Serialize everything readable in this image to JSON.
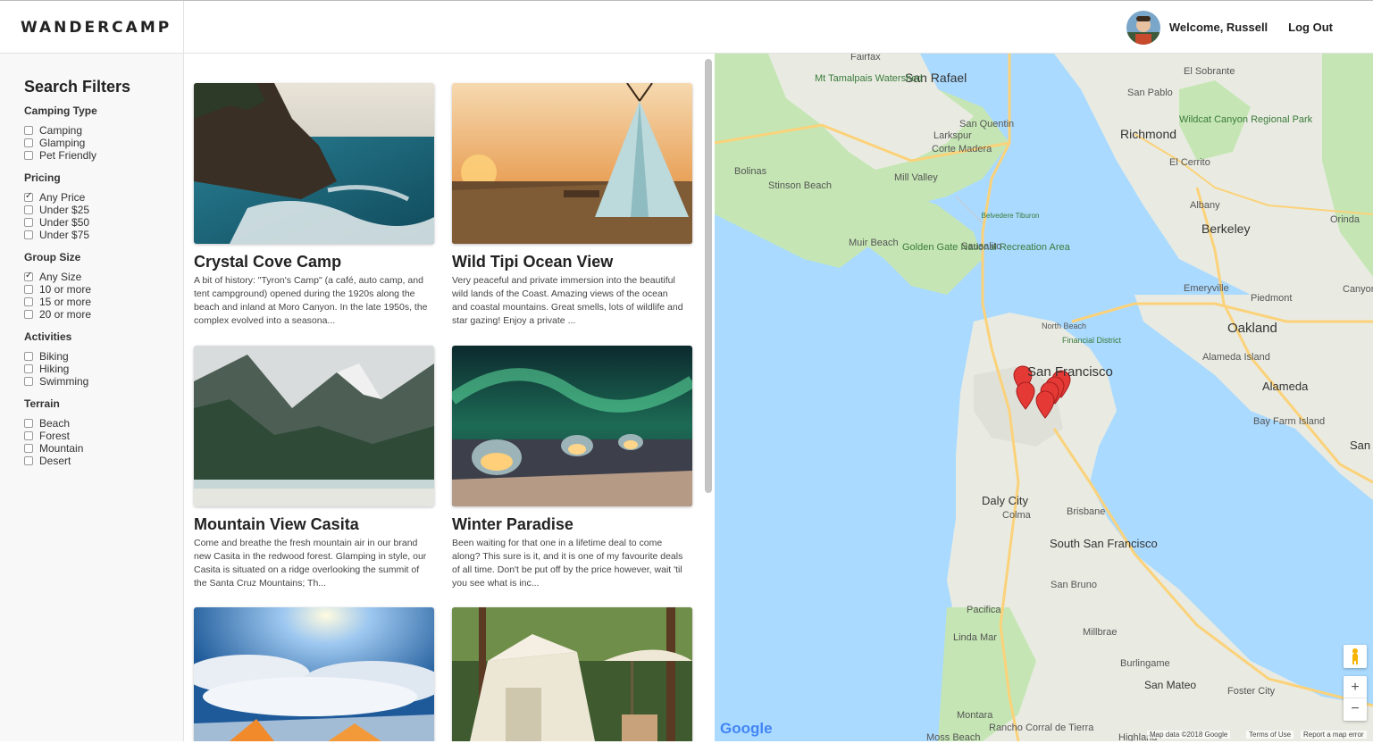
{
  "header": {
    "brand": "WANDERCAMP",
    "welcome": "Welcome, Russell",
    "logout": "Log Out"
  },
  "filters": {
    "title": "Search Filters",
    "groups": [
      {
        "label": "Camping Type",
        "options": [
          {
            "label": "Camping",
            "checked": false
          },
          {
            "label": "Glamping",
            "checked": false
          },
          {
            "label": "Pet Friendly",
            "checked": false
          }
        ]
      },
      {
        "label": "Pricing",
        "options": [
          {
            "label": "Any Price",
            "checked": true
          },
          {
            "label": "Under $25",
            "checked": false
          },
          {
            "label": "Under $50",
            "checked": false
          },
          {
            "label": "Under $75",
            "checked": false
          }
        ]
      },
      {
        "label": "Group Size",
        "options": [
          {
            "label": "Any Size",
            "checked": true
          },
          {
            "label": "10 or more",
            "checked": false
          },
          {
            "label": "15 or more",
            "checked": false
          },
          {
            "label": "20 or more",
            "checked": false
          }
        ]
      },
      {
        "label": "Activities",
        "options": [
          {
            "label": "Biking",
            "checked": false
          },
          {
            "label": "Hiking",
            "checked": false
          },
          {
            "label": "Swimming",
            "checked": false
          }
        ]
      },
      {
        "label": "Terrain",
        "options": [
          {
            "label": "Beach",
            "checked": false
          },
          {
            "label": "Forest",
            "checked": false
          },
          {
            "label": "Mountain",
            "checked": false
          },
          {
            "label": "Desert",
            "checked": false
          }
        ]
      }
    ]
  },
  "listings": [
    {
      "title": "Crystal Cove Camp",
      "desc": "A bit of history: \"Tyron's Camp\" (a café, auto camp, and tent campground) opened during the 1920s along the beach and inland at Moro Canyon. In the late 1950s, the complex evolved into a seasona..."
    },
    {
      "title": "Wild Tipi Ocean View",
      "desc": "Very peaceful and private immersion into the beautiful wild lands of the Coast. Amazing views of the ocean and coastal mountains. Great smells, lots of wildlife and star gazing! Enjoy a private ..."
    },
    {
      "title": "Mountain View Casita",
      "desc": "Come and breathe the fresh mountain air in our brand new Casita in the redwood forest. Glamping in style, our Casita is situated on a ridge overlooking the summit of the Santa Cruz Mountains; Th..."
    },
    {
      "title": "Winter Paradise",
      "desc": "Been waiting for that one in a lifetime deal to come along? This sure is it, and it is one of my favourite deals of all time. Don't be put off by the price however, wait 'til you see what is inc..."
    },
    {
      "title": "",
      "desc": ""
    },
    {
      "title": "",
      "desc": ""
    }
  ],
  "map": {
    "labels": [
      "Fairfax",
      "San Rafael",
      "El Sobrante",
      "Mt Tamalpais Watershed",
      "San Pablo",
      "Wildcat Canyon Regional Park",
      "San Quentin",
      "Richmond",
      "Larkspur",
      "Corte Madera",
      "El Cerrito",
      "Bolinas",
      "Stinson Beach",
      "Mill Valley",
      "Albany",
      "Orinda",
      "Belvedere Tiburon",
      "Berkeley",
      "Muir Beach",
      "Golden Gate National Recreation Area",
      "Sausalito",
      "Emeryville",
      "Canyon",
      "Piedmont",
      "North Beach",
      "Financial District",
      "Oakland",
      "San Francisco",
      "Alameda Island",
      "Alameda",
      "Bay Farm Island",
      "San Le",
      "Daly City",
      "Colma",
      "Brisbane",
      "South San Francisco",
      "San Bruno",
      "Pacifica",
      "Millbrae",
      "Linda Mar",
      "Burlingame",
      "San Mateo",
      "Foster City",
      "Montara",
      "Rancho Corral de Tierra",
      "Moss Beach",
      "Highland"
    ],
    "attribution": "Map data ©2018 Google",
    "terms": "Terms of Use",
    "report": "Report a map error",
    "google": "Google",
    "zoom_in": "+",
    "zoom_out": "−",
    "colors": {
      "water": "#aadaff",
      "land": "#e8e8e0",
      "park": "#c5e6b4",
      "highway": "#fbd27a",
      "pin": "#e53935"
    }
  }
}
